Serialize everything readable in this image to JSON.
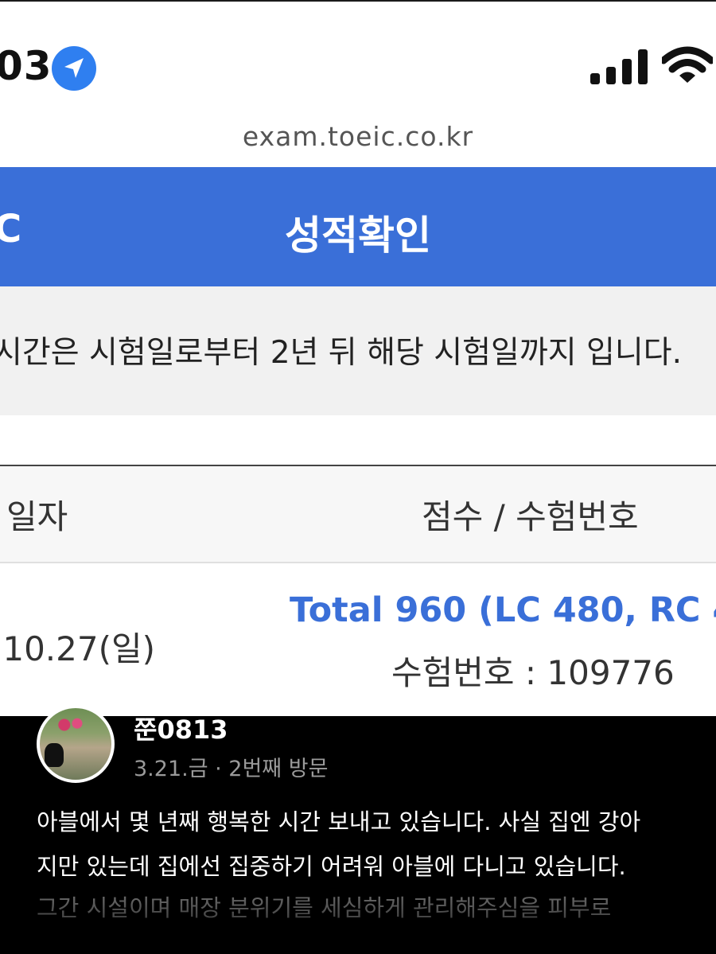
{
  "status_bar": {
    "time": "03"
  },
  "browser": {
    "url": "exam.toeic.co.kr"
  },
  "header": {
    "logo_fragment": "C",
    "title": "성적확인"
  },
  "notice": {
    "text": "시간은 시험일로부터 2년 뒤 해당 시험일까지 입니다."
  },
  "table": {
    "columns": [
      "일자",
      "점수 / 수험번호"
    ],
    "rows": [
      {
        "date": ".10.27(일)",
        "score": "Total 960 (LC 480, RC 48",
        "exam_number": "수험번호 : 109776"
      }
    ]
  },
  "review": {
    "username": "쭌0813",
    "visit_info": "3.21.금 · 2번째 방문",
    "lines": [
      "아블에서 몇 년째 행복한 시간 보내고 있습니다. 사실 집엔 강아",
      "지만 있는데 집에선 집중하기 어려워 아블에 다니고 있습니다.",
      "그간 시설이며 매장 분위기를 세심하게 관리해주심을 피부로"
    ]
  },
  "colors": {
    "accent": "#3a6fd8",
    "location_icon": "#2f7ff0"
  },
  "icons": [
    "location-arrow-icon",
    "cellular-signal-icon",
    "wifi-icon"
  ]
}
